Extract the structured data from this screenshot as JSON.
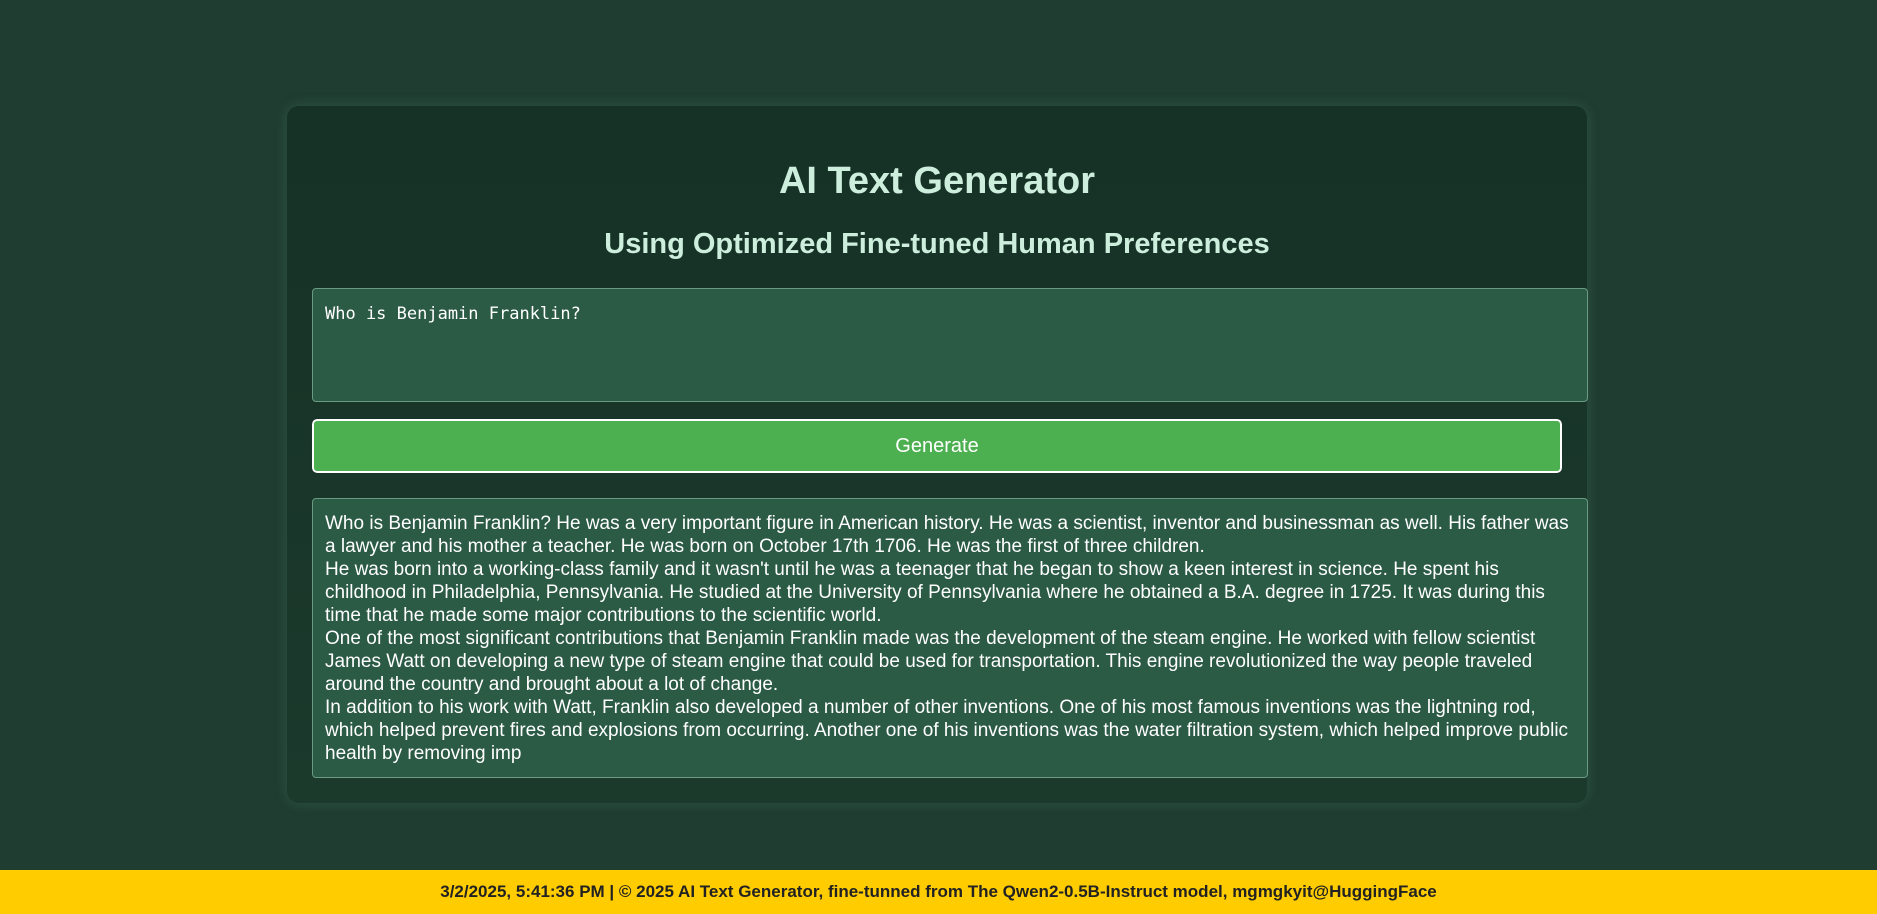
{
  "header": {
    "title": "AI Text Generator",
    "subtitle": "Using Optimized Fine-tuned Human Preferences"
  },
  "prompt": {
    "value": "Who is Benjamin Franklin?"
  },
  "generate_button": {
    "label": "Generate"
  },
  "output": {
    "paragraphs": [
      "Who is Benjamin Franklin? He was a very important figure in American history. He was a scientist, inventor and businessman as well. His father was a lawyer and his mother a teacher. He was born on October 17th 1706. He was the first of three children.",
      "He was born into a working-class family and it wasn't until he was a teenager that he began to show a keen interest in science. He spent his childhood in Philadelphia, Pennsylvania. He studied at the University of Pennsylvania where he obtained a B.A. degree in 1725. It was during this time that he made some major contributions to the scientific world.",
      "One of the most significant contributions that Benjamin Franklin made was the development of the steam engine. He worked with fellow scientist James Watt on developing a new type of steam engine that could be used for transportation. This engine revolutionized the way people traveled around the country and brought about a lot of change.",
      "In addition to his work with Watt, Franklin also developed a number of other inventions. One of his most famous inventions was the lightning rod, which helped prevent fires and explosions from occurring. Another one of his inventions was the water filtration system, which helped improve public health by removing imp"
    ]
  },
  "footer": {
    "text": "3/2/2025, 5:41:36 PM | © 2025 AI Text Generator, fine-tunned from The Qwen2-0.5B-Instruct model, mgmgkyit@HuggingFace"
  },
  "colors": {
    "background": "#1f3d31",
    "card": "#163126",
    "field": "#2b5a45",
    "button": "#4caf50",
    "footer": "#ffcc00",
    "heading": "#cdeedd"
  }
}
